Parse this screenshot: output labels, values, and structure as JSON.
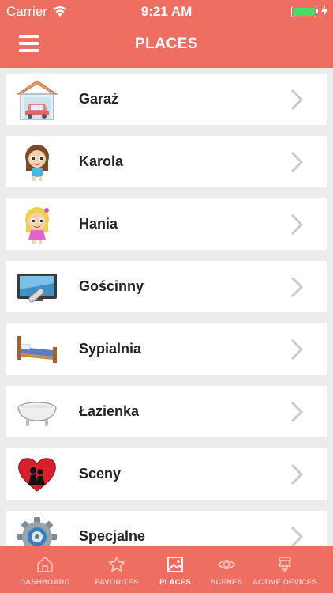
{
  "status_bar": {
    "carrier": "Carrier",
    "time": "9:21 AM",
    "battery_level": 1.0
  },
  "header": {
    "title": "PLACES"
  },
  "places": [
    {
      "label": "Garaż",
      "icon": "garage-icon"
    },
    {
      "label": "Karola",
      "icon": "girl-brown-hair-icon"
    },
    {
      "label": "Hania",
      "icon": "girl-blonde-hair-icon"
    },
    {
      "label": "Gościnny",
      "icon": "tv-remote-icon"
    },
    {
      "label": "Sypialnia",
      "icon": "bed-icon"
    },
    {
      "label": "Łazienka",
      "icon": "bathtub-icon"
    },
    {
      "label": "Sceny",
      "icon": "heart-couple-icon"
    },
    {
      "label": "Specjalne",
      "icon": "gear-icon"
    }
  ],
  "tabs": [
    {
      "label": "DASHBOARD",
      "icon": "home-icon",
      "active": false
    },
    {
      "label": "FAVORITES",
      "icon": "star-icon",
      "active": false
    },
    {
      "label": "PLACES",
      "icon": "picture-icon",
      "active": true
    },
    {
      "label": "SCENES",
      "icon": "eye-icon",
      "active": false
    },
    {
      "label": "ACTIVE DEVICES",
      "icon": "ceiling-lamp-icon",
      "active": false
    }
  ],
  "colors": {
    "accent": "#ee6e62",
    "background": "#ececec",
    "battery": "#4cd964"
  }
}
